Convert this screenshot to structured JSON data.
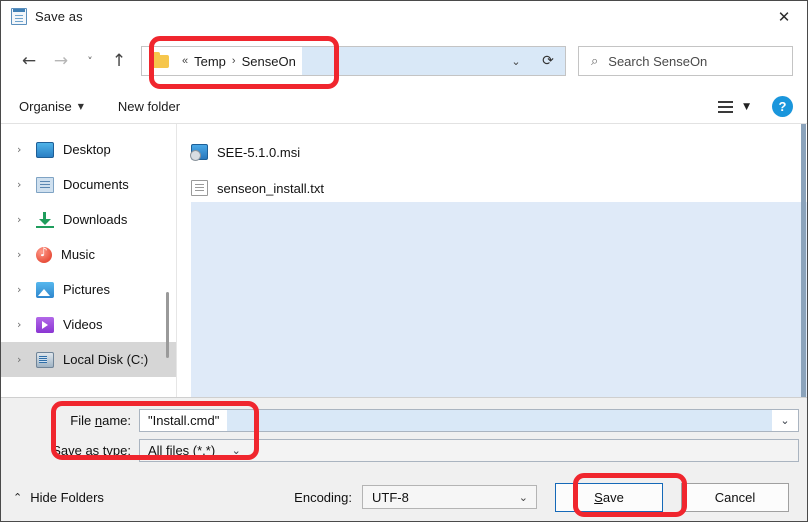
{
  "window": {
    "title": "Save as",
    "icon": "notepad-icon",
    "close_label": "✕"
  },
  "nav": {
    "back": "←",
    "forward": "→",
    "recent": "˅",
    "up": "↑",
    "breadcrumb": {
      "prefix": "«",
      "items": [
        "Temp",
        "SenseOn"
      ],
      "separator": "›"
    },
    "refresh": "⟳",
    "dropdown_caret": "⌄"
  },
  "search": {
    "placeholder": "Search SenseOn",
    "icon": "search-icon",
    "glyph": "⌕"
  },
  "toolbar": {
    "organise_label": "Organise",
    "organise_caret": "▼",
    "new_folder_label": "New folder",
    "view_caret": "▼",
    "help_label": "?"
  },
  "sidebar": {
    "items": [
      {
        "label": "Desktop",
        "icon": "desktop-icon",
        "chevron": "›",
        "selected": false
      },
      {
        "label": "Documents",
        "icon": "documents-icon",
        "chevron": "›",
        "selected": false
      },
      {
        "label": "Downloads",
        "icon": "downloads-icon",
        "chevron": "›",
        "selected": false
      },
      {
        "label": "Music",
        "icon": "music-icon",
        "chevron": "›",
        "selected": false
      },
      {
        "label": "Pictures",
        "icon": "pictures-icon",
        "chevron": "›",
        "selected": false
      },
      {
        "label": "Videos",
        "icon": "videos-icon",
        "chevron": "›",
        "selected": false
      },
      {
        "label": "Local Disk (C:)",
        "icon": "local-disk-icon",
        "chevron": "›",
        "selected": true
      }
    ]
  },
  "files": [
    {
      "name": "SEE-5.1.0.msi",
      "icon": "msi-installer-icon"
    },
    {
      "name": "senseon_install.txt",
      "icon": "text-file-icon"
    }
  ],
  "form": {
    "file_name_label_pre": "File ",
    "file_name_label_key": "n",
    "file_name_label_post": "ame:",
    "file_name_value": "\"Install.cmd\"",
    "save_type_label_pre": "Save as ",
    "save_type_label_key": "t",
    "save_type_label_post": "ype:",
    "save_type_value": "All files  (*.*)",
    "caret": "⌄"
  },
  "footer": {
    "hide_folders_label": "Hide Folders",
    "hide_folders_caret": "⌃",
    "encoding_label": "Encoding:",
    "encoding_value": "UTF-8",
    "encoding_caret": "⌄",
    "save_label_pre": "",
    "save_label_key": "S",
    "save_label_post": "ave",
    "cancel_label": "Cancel"
  },
  "colors": {
    "accent_blue": "#1a96dc",
    "selection_blue": "#dfeaf8",
    "address_fill_blue": "#d9e8f7",
    "annotation_red": "#f0262e",
    "focus_border": "#1569b8"
  }
}
